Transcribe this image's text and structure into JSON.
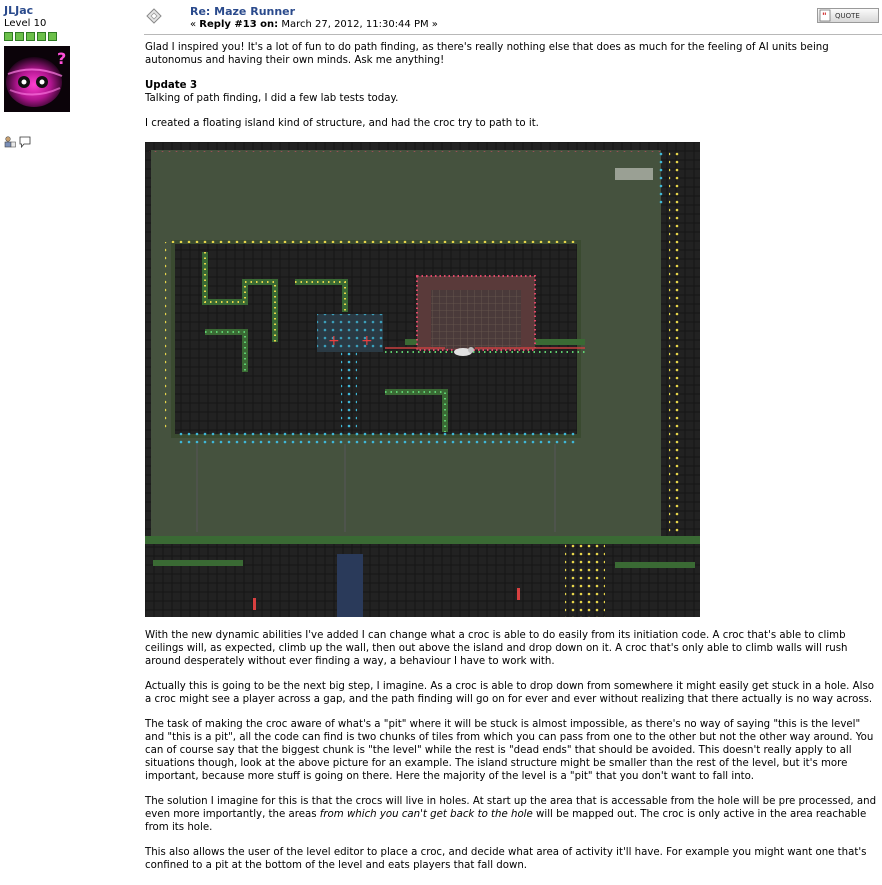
{
  "poster": {
    "username": "JLJac",
    "level": "Level 10"
  },
  "post": {
    "title": "Re: Maze Runner",
    "reply_prefix": "« ",
    "reply_label": "Reply #13 on:",
    "date": " March 27, 2012, 11:30:44 PM »",
    "quote_label": "QUOTE"
  },
  "body": {
    "p1": "Glad I inspired you! It's a lot of fun to do path finding, as there's really nothing else that does as much for the feeling of AI units being autonomus and having their own minds. Ask me anything!",
    "update_heading": "Update 3",
    "update_line": "Talking of path finding, I did a few lab tests today.",
    "p2": "I created a floating island kind of structure, and had the croc try to path to it.",
    "p3": "With the new dynamic abilities I've added I can change what a croc is able to do easily from its initiation code. A croc that's able to climb ceilings will, as expected, climb up the wall, then out above the island and drop down on it. A croc that's only able to climb walls will rush around desperately without ever finding a way, a behaviour I have to work with.",
    "p4": "Actually this is going to be the next big step, I imagine. As a croc is able to drop down from somewhere it might easily get stuck in a hole. Also a croc might see a player across a gap, and the path finding will go on for ever and ever without realizing that there actually is no way across.",
    "p5": "The task of making the croc aware of what's a \"pit\" where it will be stuck is almost impossible, as there's no way of saying \"this is the level\" and \"this is a pit\", all the code can find is two chunks of tiles from which you can pass from one to the other but not the other way around. You can of course say that the biggest chunk is \"the level\" while the rest is \"dead ends\" that should be avoided. This doesn't really apply to all situations though, look at the above picture for an example. The island structure might be smaller than the rest of the level, but it's more important, because more stuff is going on there. Here the majority of the level is a \"pit\" that you don't want to fall into.",
    "p6_a": "The solution I imagine for this is that the crocs will live in holes. At start up the area that is accessable from the hole will be pre processed, and even more importantly, the areas ",
    "p6_em": "from which you can't get back to the hole",
    "p6_b": " will be mapped out. The croc is only active in the area reachable from its hole.",
    "p7": "This also allows the user of the level editor to place a croc, and decide what area of activity it'll have. For example you might want one that's confined to a pit at the bottom of the level and eats players that fall down."
  },
  "icons": [
    "post-icon",
    "profile-icon",
    "pm-icon",
    "quote-icon"
  ],
  "colors": {
    "link": "#2a4a8c",
    "star": "#6cc04a"
  }
}
